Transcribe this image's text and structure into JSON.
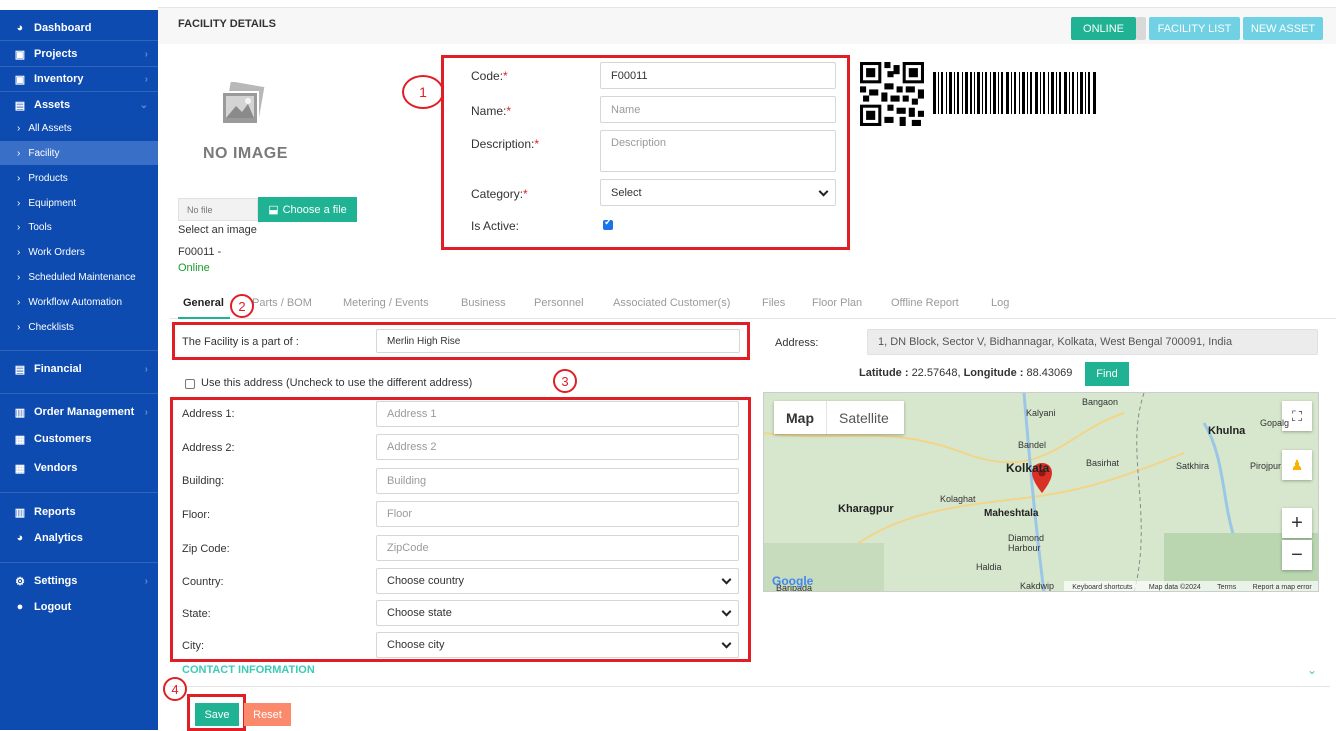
{
  "sidebar": {
    "items": [
      {
        "label": "Dashboard",
        "icon": "dashboard-icon"
      },
      {
        "label": "Projects",
        "icon": "briefcase-icon"
      },
      {
        "label": "Inventory",
        "icon": "briefcase-icon"
      },
      {
        "label": "Assets",
        "icon": "asset-icon"
      }
    ],
    "asset_subitems": [
      "All Assets",
      "Facility",
      "Products",
      "Equipment",
      "Tools",
      "Work Orders",
      "Scheduled Maintenance",
      "Workflow Automation",
      "Checklists"
    ],
    "lower_items": [
      {
        "label": "Financial",
        "icon": "financial-icon"
      },
      {
        "label": "Order Management",
        "icon": "file-icon"
      },
      {
        "label": "Customers",
        "icon": "calendar-icon"
      },
      {
        "label": "Vendors",
        "icon": "calendar-icon"
      },
      {
        "label": "Reports",
        "icon": "file-icon"
      },
      {
        "label": "Analytics",
        "icon": "dashboard-icon"
      },
      {
        "label": "Settings",
        "icon": "gear-icon"
      },
      {
        "label": "Logout",
        "icon": "user-icon"
      }
    ]
  },
  "header": {
    "title": "FACILITY DETAILS",
    "online_label": "ONLINE",
    "facility_list_label": "FACILITY LIST",
    "new_asset_label": "NEW ASSET"
  },
  "image_panel": {
    "no_image_text": "NO IMAGE",
    "no_file_text": "No file",
    "choose_file_label": "Choose a file",
    "select_image_text": "Select an image",
    "code_line": "F00011 -",
    "status_text": "Online"
  },
  "form": {
    "code_label": "Code:",
    "code_value": "F00011",
    "name_label": "Name:",
    "name_placeholder": "Name",
    "description_label": "Description:",
    "description_placeholder": "Description",
    "category_label": "Category:",
    "category_value": "Select",
    "is_active_label": "Is Active:",
    "required_mark": "*",
    "is_active": true
  },
  "annotations": [
    "1",
    "2",
    "3",
    "4"
  ],
  "tabs": [
    "General",
    "Parts / BOM",
    "Metering / Events",
    "Business",
    "Personnel",
    "Associated Customer(s)",
    "Files",
    "Floor Plan",
    "Offline Report",
    "Log"
  ],
  "general": {
    "part_of_label": "The Facility is a part of :",
    "part_of_value": "Merlin High Rise",
    "use_address_label": "Use this address (Uncheck to use the different address)",
    "address1_label": "Address 1:",
    "address1_placeholder": "Address 1",
    "address2_label": "Address 2:",
    "address2_placeholder": "Address 2",
    "building_label": "Building:",
    "building_placeholder": "Building",
    "floor_label": "Floor:",
    "floor_placeholder": "Floor",
    "zip_label": "Zip Code:",
    "zip_placeholder": "ZipCode",
    "country_label": "Country:",
    "country_value": "Choose country",
    "state_label": "State:",
    "state_value": "Choose state",
    "city_label": "City:",
    "city_value": "Choose city"
  },
  "location": {
    "address_label": "Address:",
    "address_value": "1, DN Block, Sector V, Bidhannagar, Kolkata, West Bengal 700091, India",
    "latitude_label": "Latitude :",
    "latitude_value": "22.57648",
    "longitude_label": "Longitude :",
    "longitude_value": "88.43069",
    "find_label": "Find"
  },
  "map": {
    "map_tab": "Map",
    "satellite_tab": "Satellite",
    "labels": [
      "Bangaon",
      "Kalyani",
      "Bandel",
      "Khulna",
      "Gopalg",
      "Basirhat",
      "Satkhira",
      "Pirojpur",
      "Kolkata",
      "Kolaghat",
      "Kharagpur",
      "Maheshtala",
      "Diamond Harbour",
      "Haldia",
      "Kakdwip",
      "Baripada"
    ],
    "footer": [
      "Keyboard shortcuts",
      "Map data ©2024",
      "Terms",
      "Report a map error"
    ],
    "google": "Google"
  },
  "footer": {
    "contact_label": "CONTACT INFORMATION",
    "save_label": "Save",
    "reset_label": "Reset"
  },
  "colors": {
    "sidebar": "#0d4bb0",
    "accent": "#1fb394",
    "light_button": "#6fd1e3",
    "annotation": "#e01e25",
    "reset": "#fa8a6b"
  }
}
